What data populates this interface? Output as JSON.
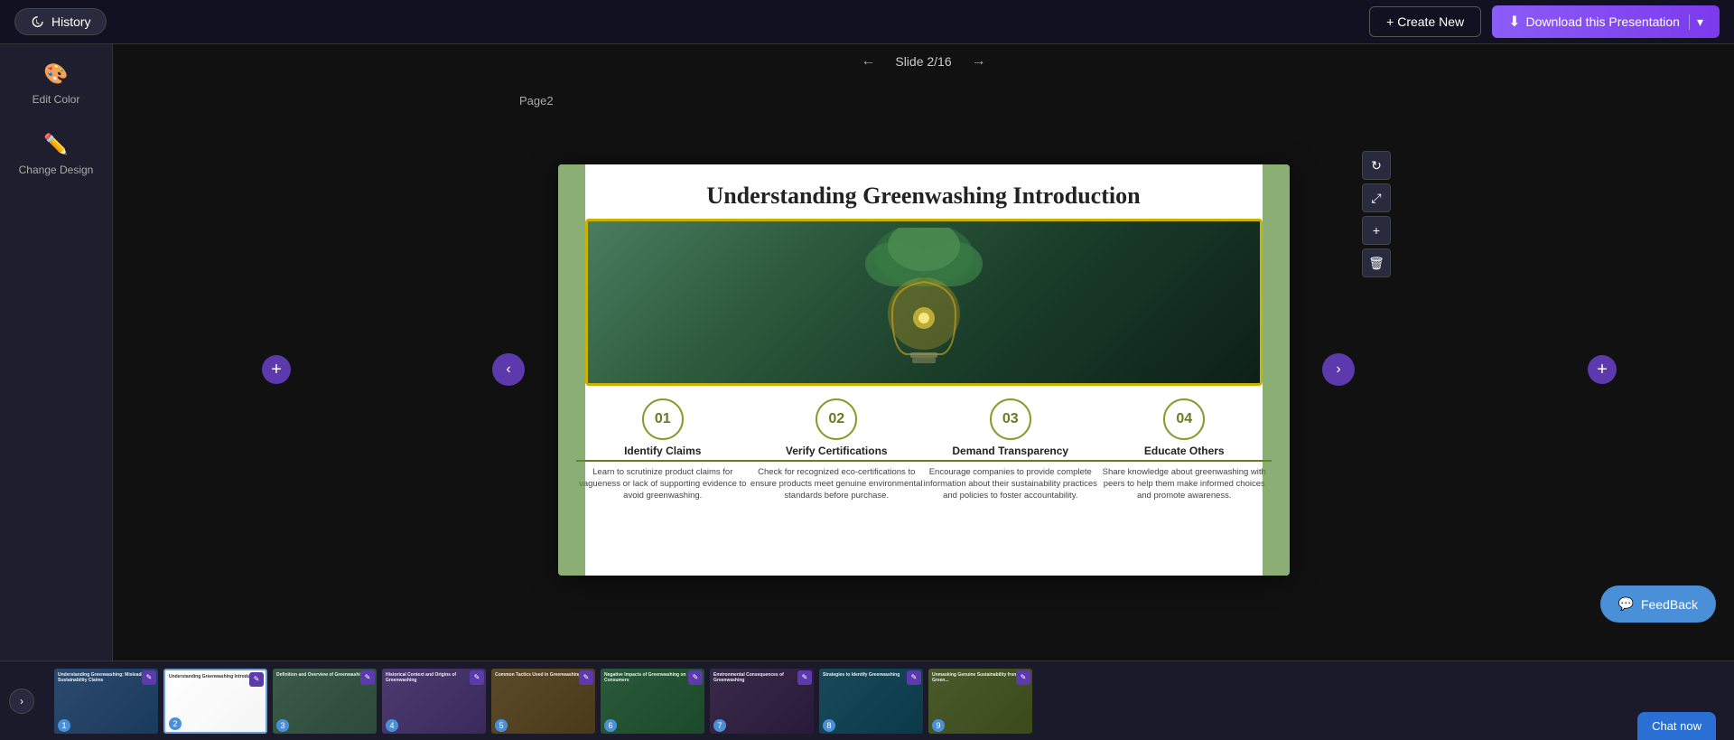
{
  "topNav": {
    "historyLabel": "History",
    "createNewLabel": "+ Create New",
    "downloadLabel": "Download this Presentation",
    "downloadChevron": "▾"
  },
  "sidebar": {
    "editColorLabel": "Edit Color",
    "changeDesignLabel": "Change Design"
  },
  "slideNav": {
    "pageLabel": "Page2",
    "slideInfo": "Slide 2/16",
    "prevArrow": "←",
    "nextArrow": "→"
  },
  "slide": {
    "title": "Understanding Greenwashing Introduction",
    "columns": [
      {
        "number": "01",
        "heading": "Identify Claims",
        "text": "Learn to scrutinize product claims for vagueness or lack of supporting evidence to avoid greenwashing."
      },
      {
        "number": "02",
        "heading": "Verify Certifications",
        "text": "Check for recognized eco-certifications to ensure products meet genuine environmental standards before purchase."
      },
      {
        "number": "03",
        "heading": "Demand Transparency",
        "text": "Encourage companies to provide complete information about their sustainability practices and policies to foster accountability."
      },
      {
        "number": "04",
        "heading": "Educate Others",
        "text": "Share knowledge about greenwashing with peers to help them make informed choices and promote awareness."
      }
    ]
  },
  "toolbar": {
    "refreshIcon": "↻",
    "resizeIcon": "⤢",
    "addIcon": "+",
    "deleteIcon": "🗑"
  },
  "feedback": {
    "label": "FeedBack"
  },
  "filmstrip": {
    "prevArrow": "‹",
    "nextArrow": "›",
    "slides": [
      {
        "num": 1,
        "label": "Understanding Greenwashing: Misleading Sustainability Claims"
      },
      {
        "num": 2,
        "label": "Understanding Greenwashing Introduction"
      },
      {
        "num": 3,
        "label": "Definition and Overview of Greenwashing"
      },
      {
        "num": 4,
        "label": "Historical Context and Origins of Greenwashing"
      },
      {
        "num": 5,
        "label": "Common Tactics Used in Greenwashing"
      },
      {
        "num": 6,
        "label": "Negative Impacts of Greenwashing on Consumers"
      },
      {
        "num": 7,
        "label": "Environmental Consequences of Greenwashing"
      },
      {
        "num": 8,
        "label": "Strategies to Identify Greenwashing"
      },
      {
        "num": 9,
        "label": "Unmasking Genuine Sustainability from Green..."
      }
    ]
  },
  "chat": {
    "label": "Chat now"
  }
}
